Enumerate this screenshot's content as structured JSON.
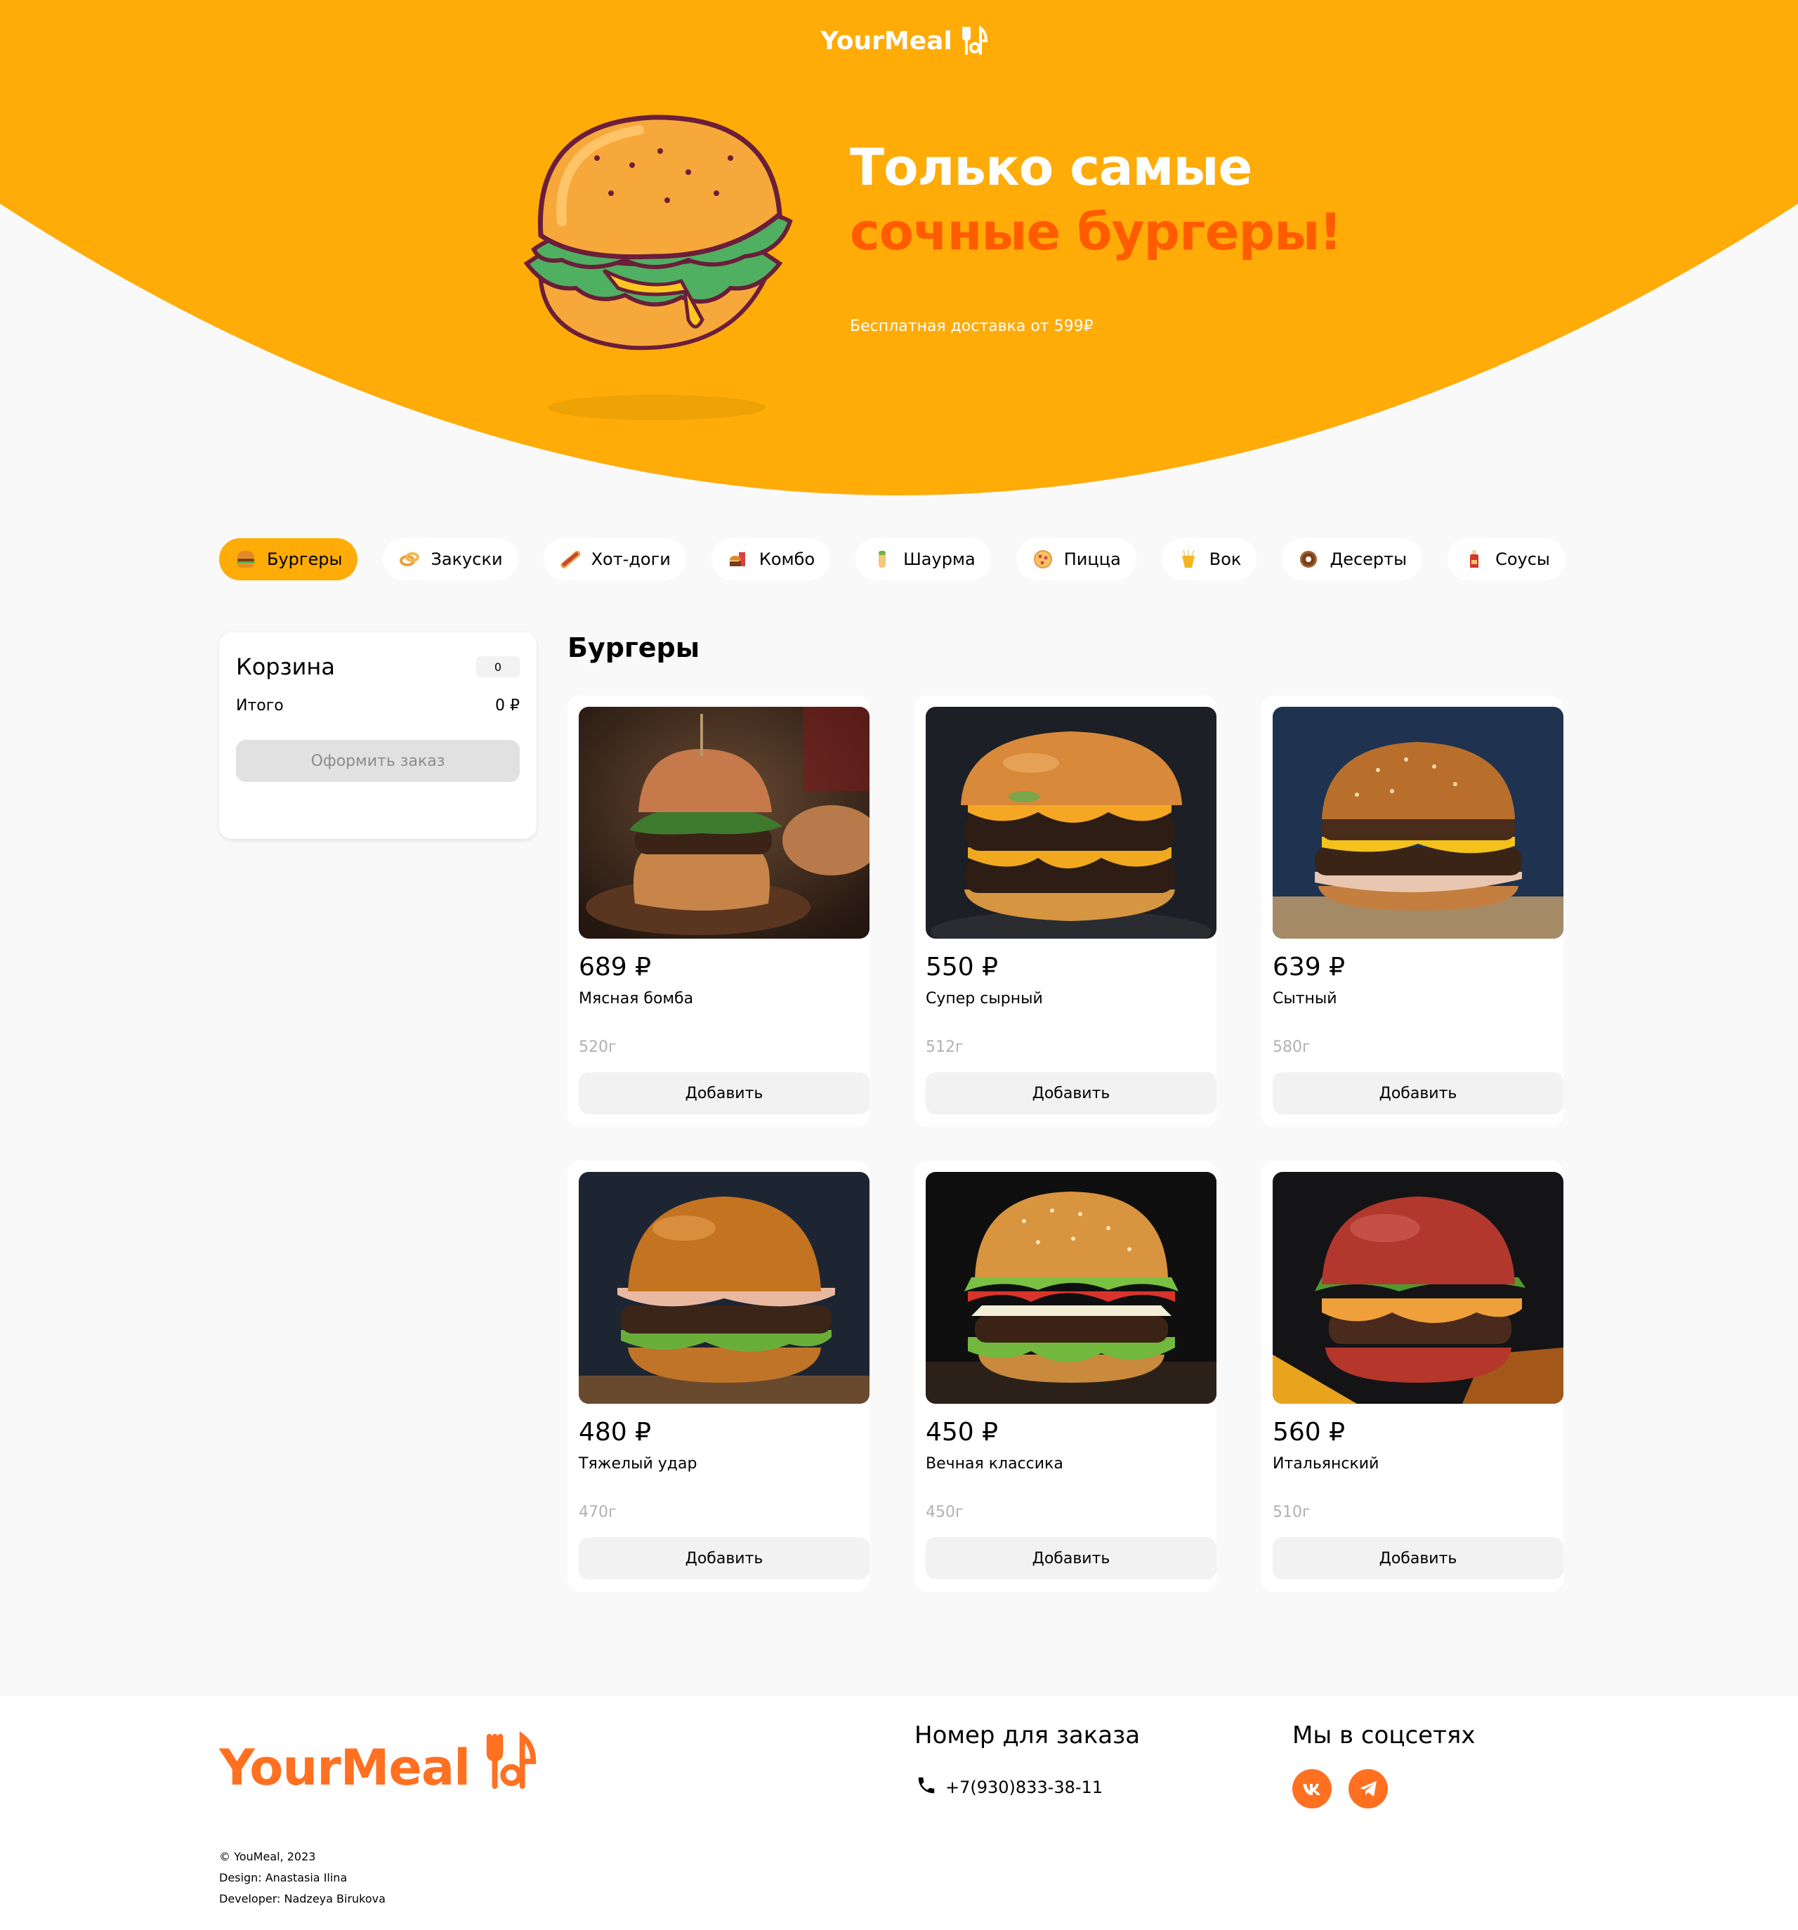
{
  "brand": {
    "name": "YourMeal",
    "accent": "#FFAB08",
    "orange": "#FF5C00",
    "footer_orange": "#FF7020"
  },
  "hero": {
    "title_line1": "Только самые",
    "title_line2": "сочные бургеры!",
    "subtitle": "Бесплатная доставка от 599₽"
  },
  "categories": [
    {
      "label": "Бургеры",
      "icon": "burger-icon",
      "active": true
    },
    {
      "label": "Закуски",
      "icon": "onion-rings-icon"
    },
    {
      "label": "Хот-доги",
      "icon": "hotdog-icon"
    },
    {
      "label": "Комбо",
      "icon": "combo-icon"
    },
    {
      "label": "Шаурма",
      "icon": "shawarma-icon"
    },
    {
      "label": "Пицца",
      "icon": "pizza-icon"
    },
    {
      "label": "Вок",
      "icon": "wok-icon"
    },
    {
      "label": "Десерты",
      "icon": "donut-icon"
    },
    {
      "label": "Соусы",
      "icon": "sauce-icon"
    }
  ],
  "cart": {
    "title": "Корзина",
    "count": "0",
    "total_label": "Итого",
    "total_value": "0 ₽",
    "checkout_label": "Оформить заказ"
  },
  "section_title": "Бургеры",
  "products": [
    {
      "price": "689 ₽",
      "name": "Мясная бомба",
      "weight": "520г",
      "button": "Добавить"
    },
    {
      "price": "550 ₽",
      "name": "Супер сырный",
      "weight": "512г",
      "button": "Добавить"
    },
    {
      "price": "639 ₽",
      "name": "Сытный",
      "weight": "580г",
      "button": "Добавить"
    },
    {
      "price": "480 ₽",
      "name": "Тяжелый удар",
      "weight": "470г",
      "button": "Добавить"
    },
    {
      "price": "450 ₽",
      "name": "Вечная классика",
      "weight": "450г",
      "button": "Добавить"
    },
    {
      "price": "560 ₽",
      "name": "Итальянский",
      "weight": "510г",
      "button": "Добавить"
    }
  ],
  "footer": {
    "order_title": "Номер для заказа",
    "phone": "+7(930)833-38-11",
    "social_title": "Мы в соцсетях",
    "socials": [
      "vk-icon",
      "telegram-icon"
    ],
    "copyright": "© YouMeal, 2023",
    "design": "Design: Anastasia Ilina",
    "developer": "Developer: Nadzeya Birukova"
  }
}
